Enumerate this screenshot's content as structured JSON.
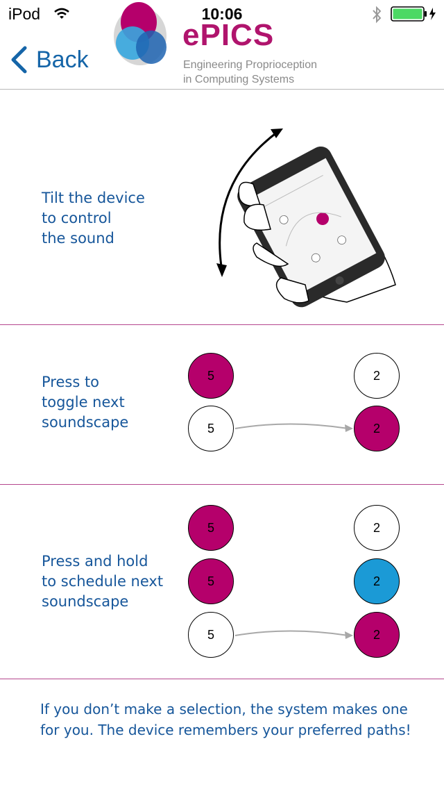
{
  "status_bar": {
    "carrier": "iPod",
    "time": "10:06"
  },
  "header": {
    "back_label": "Back",
    "logo_wordmark": "ePICS",
    "logo_subtitle_line1": "Engineering Proprioception",
    "logo_subtitle_line2": "in Computing Systems"
  },
  "tilt_section": {
    "caption_lines": [
      "Tilt the device",
      "to control",
      "the sound"
    ]
  },
  "toggle_section": {
    "caption_lines": [
      "Press to",
      "toggle next",
      "soundscape"
    ],
    "left_circles": [
      "5",
      "5"
    ],
    "right_circles": [
      "2",
      "2"
    ]
  },
  "schedule_section": {
    "caption_lines": [
      "Press and hold",
      "to schedule next",
      "soundscape"
    ],
    "left_circles": [
      "5",
      "5",
      "5"
    ],
    "right_circles": [
      "2",
      "2",
      "2"
    ]
  },
  "footer": {
    "line1": "If you don’t make a selection, the system makes one",
    "line2": "for you. The device remembers your preferred paths!"
  },
  "colors": {
    "accent_blue": "#16569a",
    "brand_magenta": "#b5006b",
    "scheduled_blue": "#1b9ad6",
    "divider": "#b5468d"
  }
}
